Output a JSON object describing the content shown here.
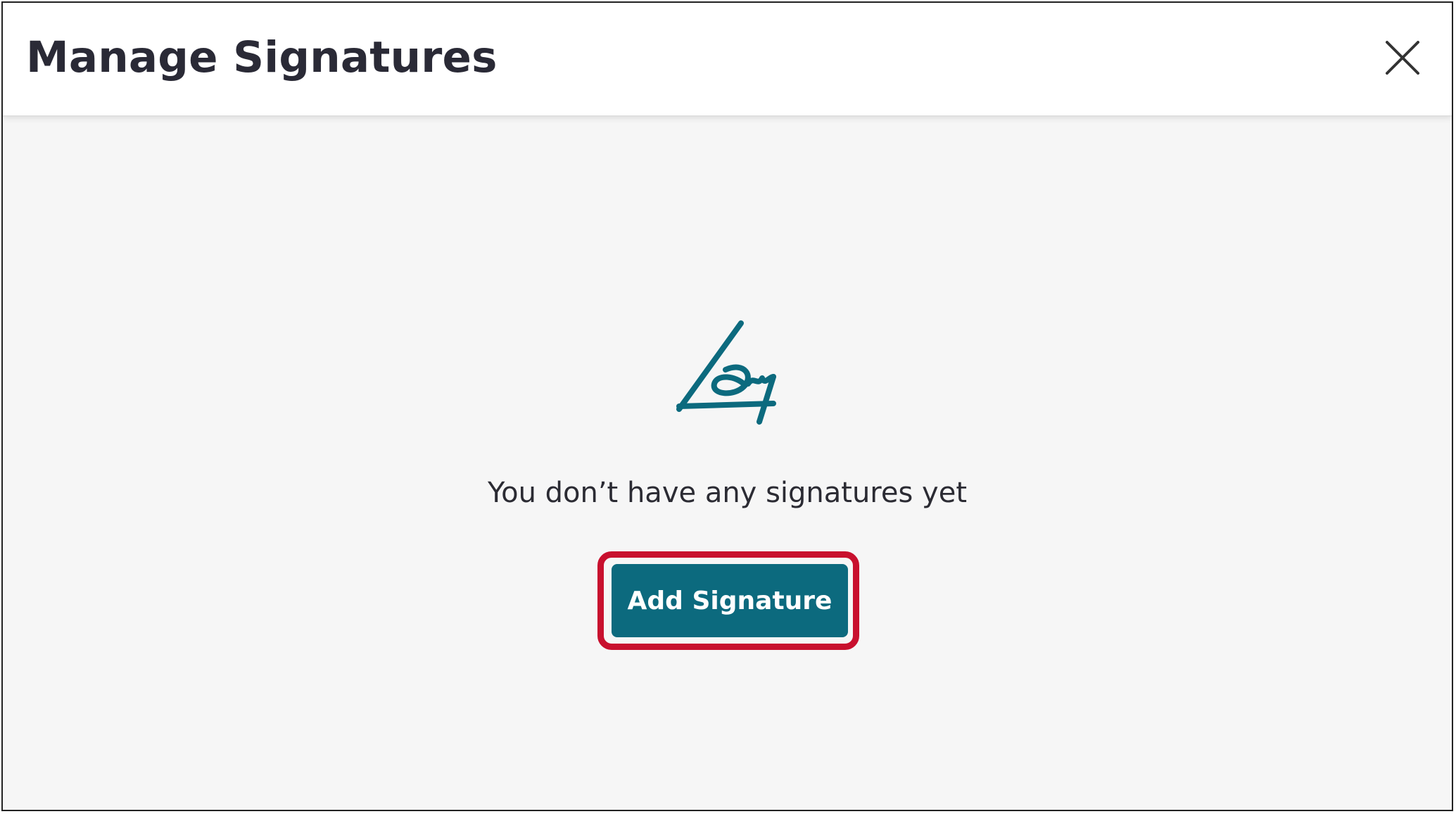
{
  "dialog": {
    "title": "Manage Signatures",
    "close_icon": "close-icon"
  },
  "empty_state": {
    "icon": "signature-icon",
    "message": "You don’t have any signatures yet",
    "add_button_label": "Add Signature"
  },
  "colors": {
    "accent": "#0c6a7e",
    "highlight": "#c8102e",
    "title_text": "#2a2a36",
    "body_background": "#f6f6f6"
  }
}
